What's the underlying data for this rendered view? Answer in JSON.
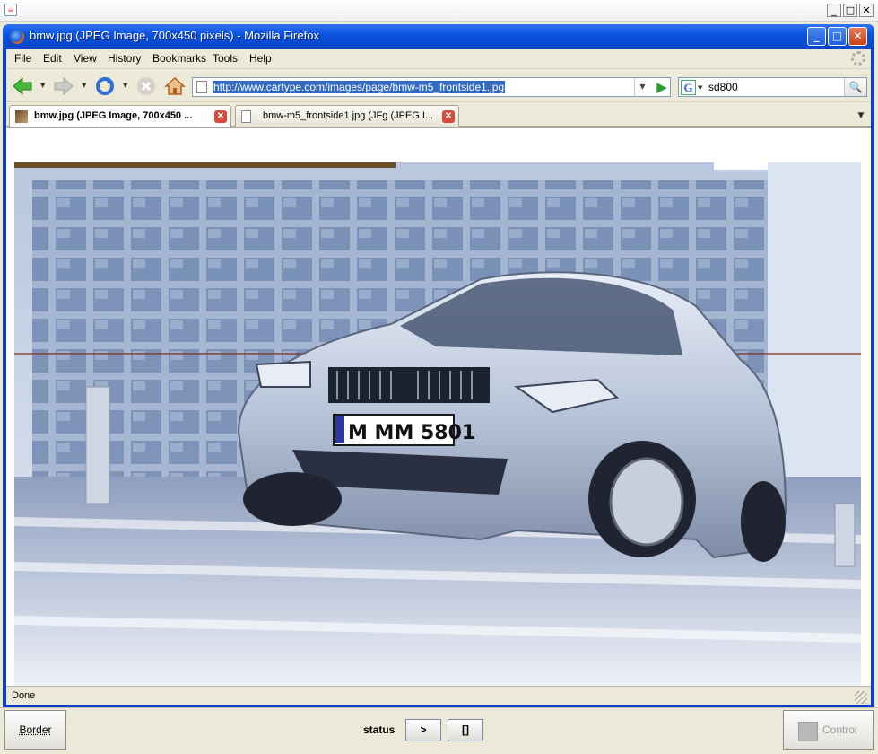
{
  "outer_window": {
    "controls": [
      "_",
      "□",
      "✕"
    ]
  },
  "browser": {
    "title": "bmw.jpg (JPEG Image, 700x450 pixels) - Mozilla Firefox",
    "window_controls": [
      "_",
      "□",
      "✕"
    ]
  },
  "menu": {
    "items": [
      {
        "label": "File"
      },
      {
        "label": "Edit"
      },
      {
        "label": "View"
      },
      {
        "label": "History"
      },
      {
        "label": "Bookmarks"
      },
      {
        "label": "Tools"
      },
      {
        "label": "Help"
      }
    ]
  },
  "toolbar": {
    "icons": [
      "back-arrow-icon",
      "forward-arrow-icon",
      "reload-icon",
      "stop-icon",
      "home-icon"
    ],
    "url": "http://www.cartype.com/images/page/bmw-m5_frontside1.jpg",
    "search_engine_letter": "G",
    "search_value": "sd800"
  },
  "tabs": [
    {
      "label": "bmw.jpg (JPEG Image, 700x450 ...",
      "active": true
    },
    {
      "label": "bmw-m5_frontside1.jpg (JFg (JPEG I...",
      "active": false
    }
  ],
  "content": {
    "plate_text": "M MM 5801"
  },
  "statusbar": {
    "text": "Done"
  },
  "bottom_panel": {
    "border_label": "Border",
    "status_label": "status",
    "next_label": ">",
    "brackets_label": "[]",
    "control_label": "Control"
  },
  "colors": {
    "xp_title": "#0a52e0",
    "selection": "#316ac5",
    "tab_close": "#d94a3a"
  }
}
